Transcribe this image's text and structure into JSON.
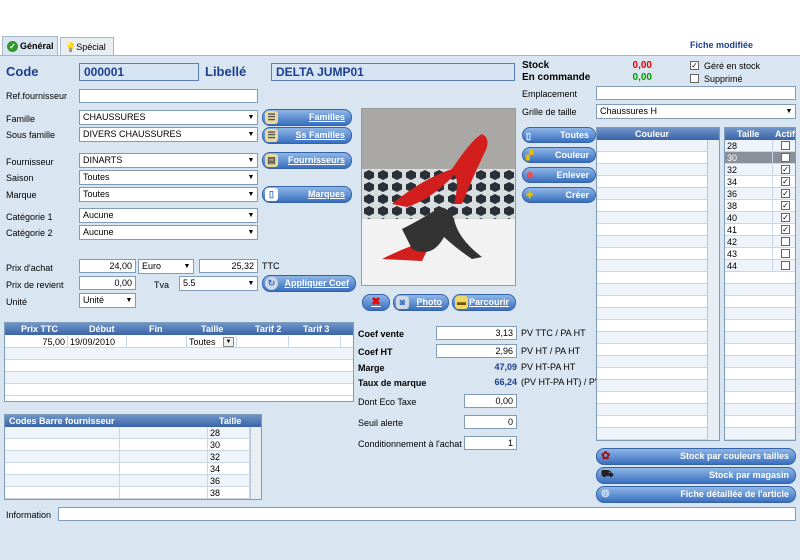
{
  "tabs": {
    "general": "Général",
    "special": "Spécial"
  },
  "status": "Fiche modifiée",
  "code": {
    "label": "Code",
    "value": "000001"
  },
  "libelle": {
    "label": "Libellé",
    "value": "DELTA JUMP01"
  },
  "ref_fournisseur": {
    "label": "Ref.fournisseur",
    "value": ""
  },
  "famille": {
    "label": "Famille",
    "value": "CHAUSSURES"
  },
  "sous_famille": {
    "label": "Sous famille",
    "value": "DIVERS CHAUSSURES"
  },
  "fournisseur": {
    "label": "Fournisseur",
    "value": "DINARTS"
  },
  "saison": {
    "label": "Saison",
    "value": "Toutes"
  },
  "marque": {
    "label": "Marque",
    "value": "Toutes"
  },
  "categorie1": {
    "label": "Catégorie 1",
    "value": "Aucune"
  },
  "categorie2": {
    "label": "Catégorie 2",
    "value": "Aucune"
  },
  "buttons": {
    "familles": "Familles",
    "ss_familles": "Ss Familles",
    "fournisseurs": "Fournisseurs",
    "marques": "Marques",
    "appliquer_coef": "Appliquer Coef",
    "photo": "Photo",
    "parcourir": "Parcourir",
    "toutes": "Toutes",
    "couleur": "Couleur",
    "enlever": "Enlever",
    "creer": "Créer",
    "stock_couleurs": "Stock par couleurs tailles",
    "stock_magasin": "Stock par magasin",
    "fiche_detaillee": "Fiche détaillée de l'article"
  },
  "prix_achat": {
    "label": "Prix d'achat",
    "value": "24,00",
    "devise": "Euro",
    "ttc_value": "25,32",
    "ttc_label": "TTC"
  },
  "prix_revient": {
    "label": "Prix de revient",
    "value": "0,00",
    "tva_label": "Tva",
    "tva": "5.5"
  },
  "unite": {
    "label": "Unité",
    "value": "Unité"
  },
  "tarif_grid": {
    "headers": [
      "Prix TTC",
      "Début",
      "Fin",
      "Taille",
      "Tarif 2",
      "Tarif 3"
    ],
    "rows": [
      [
        "75,00",
        "19/09/2010",
        "",
        "Toutes",
        "",
        ""
      ]
    ]
  },
  "codes_barre": {
    "headers": [
      "Codes Barre fournisseur",
      "Taille"
    ],
    "sizes": [
      "28",
      "30",
      "32",
      "34",
      "36",
      "38"
    ]
  },
  "coef": {
    "vente_label": "Coef vente",
    "vente": "3,13",
    "vente_unit": "PV TTC / PA HT",
    "ht_label": "Coef HT",
    "ht": "2,96",
    "ht_unit": "PV HT / PA HT",
    "marge_label": "Marge",
    "marge": "47,09",
    "marge_unit": "PV HT-PA HT",
    "taux_label": "Taux de marque",
    "taux": "66,24",
    "taux_unit": "(PV HT-PA HT) / PV HT",
    "eco_label": "Dont Eco Taxe",
    "eco": "0,00",
    "seuil_label": "Seuil alerte",
    "seuil": "0",
    "cond_label": "Conditionnement à l'achat",
    "cond": "1"
  },
  "stock": {
    "label": "Stock",
    "value": "0,00",
    "commande_label": "En commande",
    "commande": "0,00",
    "gere_label": "Géré en stock",
    "supprime_label": "Supprimé"
  },
  "emplacement": {
    "label": "Emplacement",
    "value": ""
  },
  "grille": {
    "label": "Grille de taille",
    "value": "Chaussures H"
  },
  "couleur_grid": {
    "header": "Couleur"
  },
  "taille_grid": {
    "headers": [
      "Taille",
      "Actif"
    ],
    "rows": [
      {
        "t": "28",
        "a": false
      },
      {
        "t": "30",
        "a": false
      },
      {
        "t": "32",
        "a": true
      },
      {
        "t": "34",
        "a": true
      },
      {
        "t": "36",
        "a": true
      },
      {
        "t": "38",
        "a": true
      },
      {
        "t": "40",
        "a": true
      },
      {
        "t": "41",
        "a": true
      },
      {
        "t": "42",
        "a": false
      },
      {
        "t": "43",
        "a": false
      },
      {
        "t": "44",
        "a": false
      }
    ]
  },
  "information": {
    "label": "Information",
    "value": ""
  },
  "colors": {
    "accent": "#1c3f8e",
    "red": "#e00000",
    "green": "#009900"
  }
}
